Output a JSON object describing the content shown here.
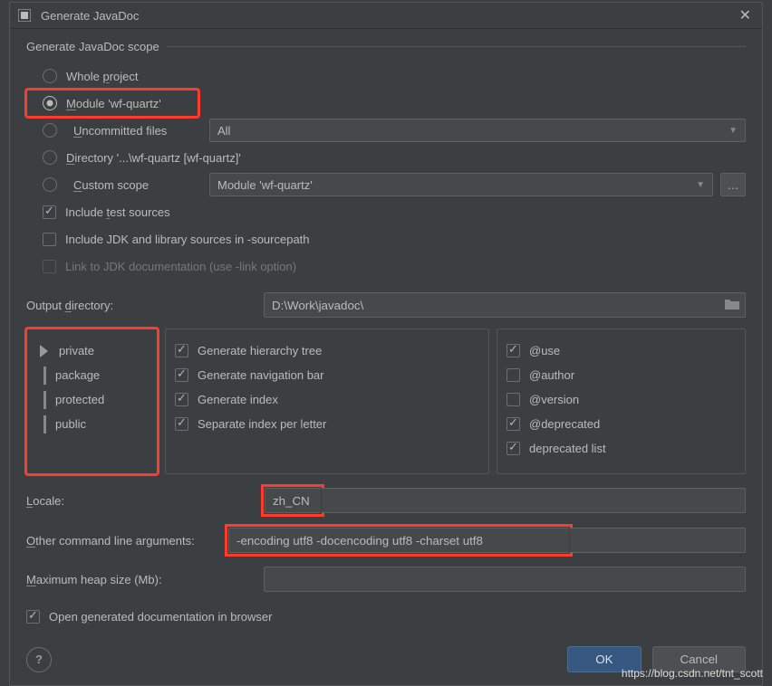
{
  "title": "Generate JavaDoc",
  "scope": {
    "legend": "Generate JavaDoc scope",
    "whole_project": "Whole project",
    "module": "Module 'wf-quartz'",
    "uncommitted": "Uncommitted files",
    "uncommitted_dd": "All",
    "directory": "Directory '...\\wf-quartz [wf-quartz]'",
    "custom": "Custom scope",
    "custom_dd": "Module 'wf-quartz'",
    "include_tests": "Include test sources",
    "include_jdk": "Include JDK and library sources in -sourcepath",
    "link_jdk": "Link to JDK documentation (use -link option)"
  },
  "output_dir_label": "Output directory:",
  "output_dir": "D:\\Work\\javadoc\\",
  "visibility": {
    "private": "private",
    "package": "package",
    "protected": "protected",
    "public": "public"
  },
  "options": {
    "hierarchy": "Generate hierarchy tree",
    "navbar": "Generate navigation bar",
    "index": "Generate index",
    "sep_index": "Separate index per letter"
  },
  "tags": {
    "use": "@use",
    "author": "@author",
    "version": "@version",
    "deprecated": "@deprecated",
    "dep_list": "deprecated list"
  },
  "locale_label": "Locale:",
  "locale": "zh_CN",
  "args_label": "Other command line arguments:",
  "args": "-encoding utf8 -docencoding utf8 -charset utf8",
  "heap_label": "Maximum heap size (Mb):",
  "heap": "",
  "open_browser": "Open generated documentation in browser",
  "ok": "OK",
  "cancel": "Cancel",
  "watermark": "https://blog.csdn.net/tnt_scott"
}
